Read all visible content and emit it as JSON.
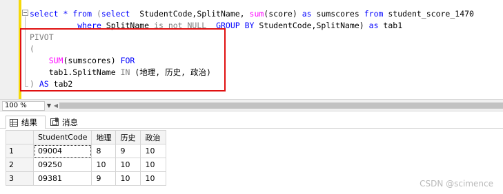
{
  "editor": {
    "lines": [
      [
        {
          "t": "select * ",
          "c": "kw"
        },
        {
          "t": "from",
          "c": "kw"
        },
        {
          "t": " (",
          "c": "gr"
        },
        {
          "t": "select",
          "c": "kw"
        },
        {
          "t": "  StudentCode,SplitName, ",
          "c": ""
        },
        {
          "t": "sum",
          "c": "fn"
        },
        {
          "t": "(score) ",
          "c": ""
        },
        {
          "t": "as",
          "c": "kw"
        },
        {
          "t": " sumscores ",
          "c": ""
        },
        {
          "t": "from",
          "c": "kw"
        },
        {
          "t": " student_score_1470",
          "c": ""
        }
      ],
      [
        {
          "t": "          ",
          "c": ""
        },
        {
          "t": "where",
          "c": "kw"
        },
        {
          "t": " SplitName ",
          "c": ""
        },
        {
          "t": "is not NULL",
          "c": "gr"
        },
        {
          "t": "  ",
          "c": ""
        },
        {
          "t": "GROUP BY",
          "c": "kw"
        },
        {
          "t": " StudentCode,SplitName) ",
          "c": ""
        },
        {
          "t": "as",
          "c": "kw"
        },
        {
          "t": " tab1",
          "c": ""
        }
      ],
      [
        {
          "t": "PIVOT",
          "c": "gr"
        }
      ],
      [
        {
          "t": "(",
          "c": "gr"
        }
      ],
      [
        {
          "t": "    ",
          "c": ""
        },
        {
          "t": "SUM",
          "c": "fn"
        },
        {
          "t": "(sumscores) ",
          "c": ""
        },
        {
          "t": "FOR",
          "c": "kw"
        }
      ],
      [
        {
          "t": "    tab1.SplitName ",
          "c": ""
        },
        {
          "t": "IN",
          "c": "gr"
        },
        {
          "t": " (地理, 历史, 政治)",
          "c": ""
        }
      ],
      [
        {
          "t": ") ",
          "c": "gr"
        },
        {
          "t": "AS",
          "c": "kw"
        },
        {
          "t": " tab2",
          "c": ""
        }
      ]
    ]
  },
  "zoom": {
    "value": "100 %"
  },
  "tabs": {
    "results": "结果",
    "messages": "消息"
  },
  "table": {
    "columns": [
      "StudentCode",
      "地理",
      "历史",
      "政治"
    ],
    "rows": [
      {
        "num": "1",
        "cells": [
          "09004",
          "8",
          "9",
          "10"
        ]
      },
      {
        "num": "2",
        "cells": [
          "09250",
          "10",
          "10",
          "10"
        ]
      },
      {
        "num": "3",
        "cells": [
          "09381",
          "9",
          "10",
          "10"
        ]
      }
    ]
  },
  "watermark": "CSDN @scimence",
  "colors": {
    "keyword": "#0000ff",
    "function": "#ff00ff",
    "operator": "#808080",
    "highlight": "#e01010",
    "change_bar": "#f5d90a"
  }
}
